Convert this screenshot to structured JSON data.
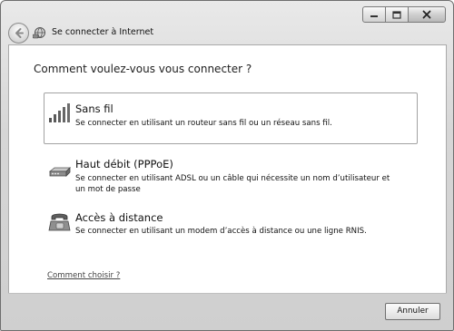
{
  "window": {
    "title": "Se connecter à Internet"
  },
  "main": {
    "heading": "Comment voulez-vous vous connecter ?",
    "options": [
      {
        "title": "Sans fil",
        "description": "Se connecter en utilisant un routeur sans fil ou un réseau sans fil.",
        "icon": "wireless-signal-icon",
        "selected": true
      },
      {
        "title": "Haut débit (PPPoE)",
        "description": "Se connecter en utilisant ADSL ou un câble qui nécessite un nom d’utilisateur et un mot de passe",
        "icon": "broadband-modem-icon"
      },
      {
        "title": "Accès à distance",
        "description": "Se connecter en utilisant un modem d’accès à distance ou une ligne RNIS.",
        "icon": "dialup-telephone-icon"
      }
    ],
    "help_link": "Comment choisir ?"
  },
  "footer": {
    "cancel_label": "Annuler"
  },
  "colors": {
    "frame": "#d6d6d6",
    "content_bg": "#ffffff",
    "selected_border": "#a2a2a2",
    "link": "#444444"
  }
}
